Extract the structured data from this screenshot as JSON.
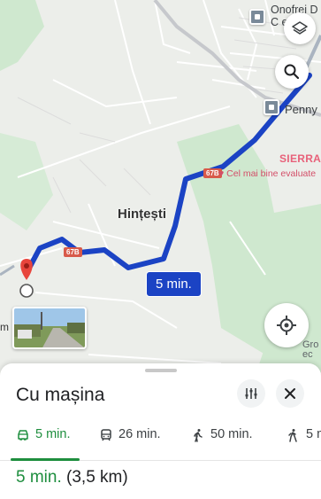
{
  "map": {
    "town_label": "Hințești",
    "poi_top": [
      "Onofrei D",
      "C       et"
    ],
    "poi_penny": "Penny",
    "sierra_label": "SIERRA",
    "best_rated_label": "Cel mai bine evaluate",
    "road_shield_1": "67B",
    "road_shield_2": "67B",
    "gro_label": [
      "Gro",
      "ec"
    ],
    "route_time": "5 min.",
    "route_color": "#1b43c4",
    "streetview_fragment": "m",
    "icons": [
      "layers-icon",
      "search-icon",
      "my-location-icon",
      "destination-pin-icon",
      "origin-circle-icon"
    ]
  },
  "sheet": {
    "title": "Cu mașina",
    "modes": [
      {
        "icon": "car-icon",
        "label": "5 min.",
        "active": true
      },
      {
        "icon": "transit-icon",
        "label": "26 min.",
        "active": false
      },
      {
        "icon": "walk-icon",
        "label": "50 min.",
        "active": false
      },
      {
        "icon": "hike-icon",
        "label": "5 m",
        "active": false
      }
    ],
    "summary_time": "5 min.",
    "summary_distance": "(3,5 km)",
    "accent_color": "#1e8e3e"
  }
}
